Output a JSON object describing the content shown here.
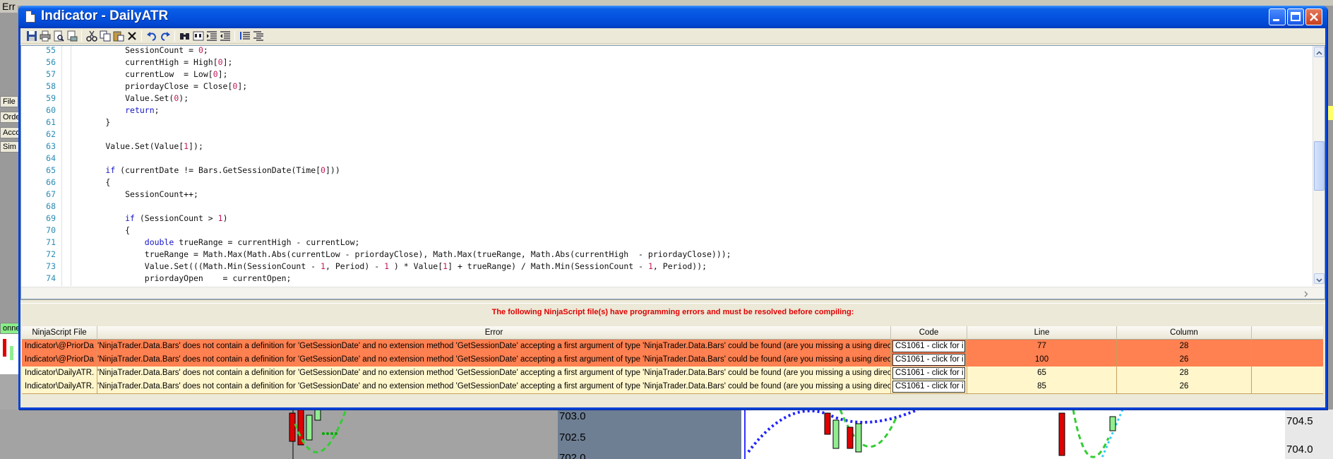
{
  "window": {
    "title": "Indicator - DailyATR",
    "minimize_label": "Minimize",
    "maximize_label": "Maximize",
    "close_label": "Close"
  },
  "background": {
    "fragments": [
      "Err",
      "File",
      "Order",
      "Acco",
      "Sim",
      "onne"
    ],
    "price_labels": [
      "703.0",
      "702.5",
      "702.0",
      "704.5",
      "704.0"
    ]
  },
  "toolbar": {
    "icons": [
      "save-icon",
      "print-icon",
      "print-preview-icon",
      "page-setup-icon",
      "cut-icon",
      "copy-icon",
      "paste-icon",
      "delete-icon",
      "undo-icon",
      "redo-icon",
      "find-icon",
      "find-replace-icon",
      "indent-icon",
      "outdent-icon",
      "comment-icon",
      "uncomment-icon"
    ]
  },
  "editor": {
    "lines": [
      {
        "n": "55",
        "parts": [
          [
            "",
            "            SessionCount = "
          ],
          [
            "num",
            "0"
          ],
          [
            "",
            ";"
          ]
        ]
      },
      {
        "n": "56",
        "parts": [
          [
            "",
            "            currentHigh = High["
          ],
          [
            "num",
            "0"
          ],
          [
            "",
            "];"
          ]
        ]
      },
      {
        "n": "57",
        "parts": [
          [
            "",
            "            currentLow  = Low["
          ],
          [
            "num",
            "0"
          ],
          [
            "",
            "];"
          ]
        ]
      },
      {
        "n": "58",
        "parts": [
          [
            "",
            "            priordayClose = Close["
          ],
          [
            "num",
            "0"
          ],
          [
            "",
            "];"
          ]
        ]
      },
      {
        "n": "59",
        "parts": [
          [
            "",
            "            Value.Set("
          ],
          [
            "num",
            "0"
          ],
          [
            "",
            ");"
          ]
        ]
      },
      {
        "n": "60",
        "parts": [
          [
            "",
            "            "
          ],
          [
            "kw",
            "return"
          ],
          [
            "",
            ";"
          ]
        ]
      },
      {
        "n": "61",
        "parts": [
          [
            "",
            "        }"
          ]
        ]
      },
      {
        "n": "62",
        "parts": [
          [
            "",
            ""
          ]
        ]
      },
      {
        "n": "63",
        "parts": [
          [
            "",
            "        Value.Set(Value["
          ],
          [
            "num",
            "1"
          ],
          [
            "",
            "]);"
          ]
        ]
      },
      {
        "n": "64",
        "parts": [
          [
            "",
            ""
          ]
        ]
      },
      {
        "n": "65",
        "parts": [
          [
            "",
            "        "
          ],
          [
            "kw",
            "if"
          ],
          [
            "",
            " (currentDate != Bars.GetSessionDate(Time["
          ],
          [
            "num",
            "0"
          ],
          [
            "",
            "]))"
          ]
        ]
      },
      {
        "n": "66",
        "parts": [
          [
            "",
            "        {"
          ]
        ]
      },
      {
        "n": "67",
        "parts": [
          [
            "",
            "            SessionCount++;"
          ]
        ]
      },
      {
        "n": "68",
        "parts": [
          [
            "",
            ""
          ]
        ]
      },
      {
        "n": "69",
        "parts": [
          [
            "",
            "            "
          ],
          [
            "kw",
            "if"
          ],
          [
            "",
            " (SessionCount > "
          ],
          [
            "num",
            "1"
          ],
          [
            "",
            ")"
          ]
        ]
      },
      {
        "n": "70",
        "parts": [
          [
            "",
            "            {"
          ]
        ]
      },
      {
        "n": "71",
        "parts": [
          [
            "",
            "                "
          ],
          [
            "kw",
            "double"
          ],
          [
            "",
            " trueRange = currentHigh - currentLow;"
          ]
        ]
      },
      {
        "n": "72",
        "parts": [
          [
            "",
            "                trueRange = Math.Max(Math.Abs(currentLow - priordayClose), Math.Max(trueRange, Math.Abs(currentHigh  - priordayClose)));"
          ]
        ]
      },
      {
        "n": "73",
        "parts": [
          [
            "",
            "                Value.Set(((Math.Min(SessionCount - "
          ],
          [
            "num",
            "1"
          ],
          [
            "",
            ", Period) - "
          ],
          [
            "num",
            "1"
          ],
          [
            "",
            " ) * Value["
          ],
          [
            "num",
            "1"
          ],
          [
            "",
            "] + trueRange) / Math.Min(SessionCount - "
          ],
          [
            "num",
            "1"
          ],
          [
            "",
            ", Period));"
          ]
        ]
      },
      {
        "n": "74",
        "parts": [
          [
            "",
            "                priordayOpen    = currentOpen;"
          ]
        ]
      }
    ]
  },
  "errors": {
    "header": "The following NinjaScript file(s) have programming errors and must be resolved before compiling:",
    "columns": [
      "NinjaScript File",
      "Error",
      "Code",
      "Line",
      "Column"
    ],
    "rows": [
      {
        "file": "Indicator\\@PriorDa",
        "error": "'NinjaTrader.Data.Bars' does not contain a definition for 'GetSessionDate' and no extension method 'GetSessionDate' accepting a first argument of type 'NinjaTrader.Data.Bars' could be found (are you missing a using directive or an assembly reference?)",
        "code": "CS1061 - click for i",
        "line": "77",
        "column": "28",
        "severity": "orange"
      },
      {
        "file": "Indicator\\@PriorDa",
        "error": "'NinjaTrader.Data.Bars' does not contain a definition for 'GetSessionDate' and no extension method 'GetSessionDate' accepting a first argument of type 'NinjaTrader.Data.Bars' could be found (are you missing a using directive or an assembly reference?)",
        "code": "CS1061 - click for i",
        "line": "100",
        "column": "26",
        "severity": "orange"
      },
      {
        "file": "Indicator\\DailyATR.",
        "error": "'NinjaTrader.Data.Bars' does not contain a definition for 'GetSessionDate' and no extension method 'GetSessionDate' accepting a first argument of type 'NinjaTrader.Data.Bars' could be found (are you missing a using directive or an assembly reference?)",
        "code": "CS1061 - click for i",
        "line": "65",
        "column": "28",
        "severity": "cream"
      },
      {
        "file": "Indicator\\DailyATR.",
        "error": "'NinjaTrader.Data.Bars' does not contain a definition for 'GetSessionDate' and no extension method 'GetSessionDate' accepting a first argument of type 'NinjaTrader.Data.Bars' could be found (are you missing a using directive or an assembly reference?)",
        "code": "CS1061 - click for i",
        "line": "85",
        "column": "26",
        "severity": "cream"
      }
    ]
  },
  "colors": {
    "titlebar": "#0553e0",
    "error_header": "#e00000",
    "row_orange": "#ff8050",
    "row_cream": "#fff6cc",
    "keyword": "#1616c8",
    "number": "#c2185b",
    "line_number": "#2b8bb3"
  }
}
